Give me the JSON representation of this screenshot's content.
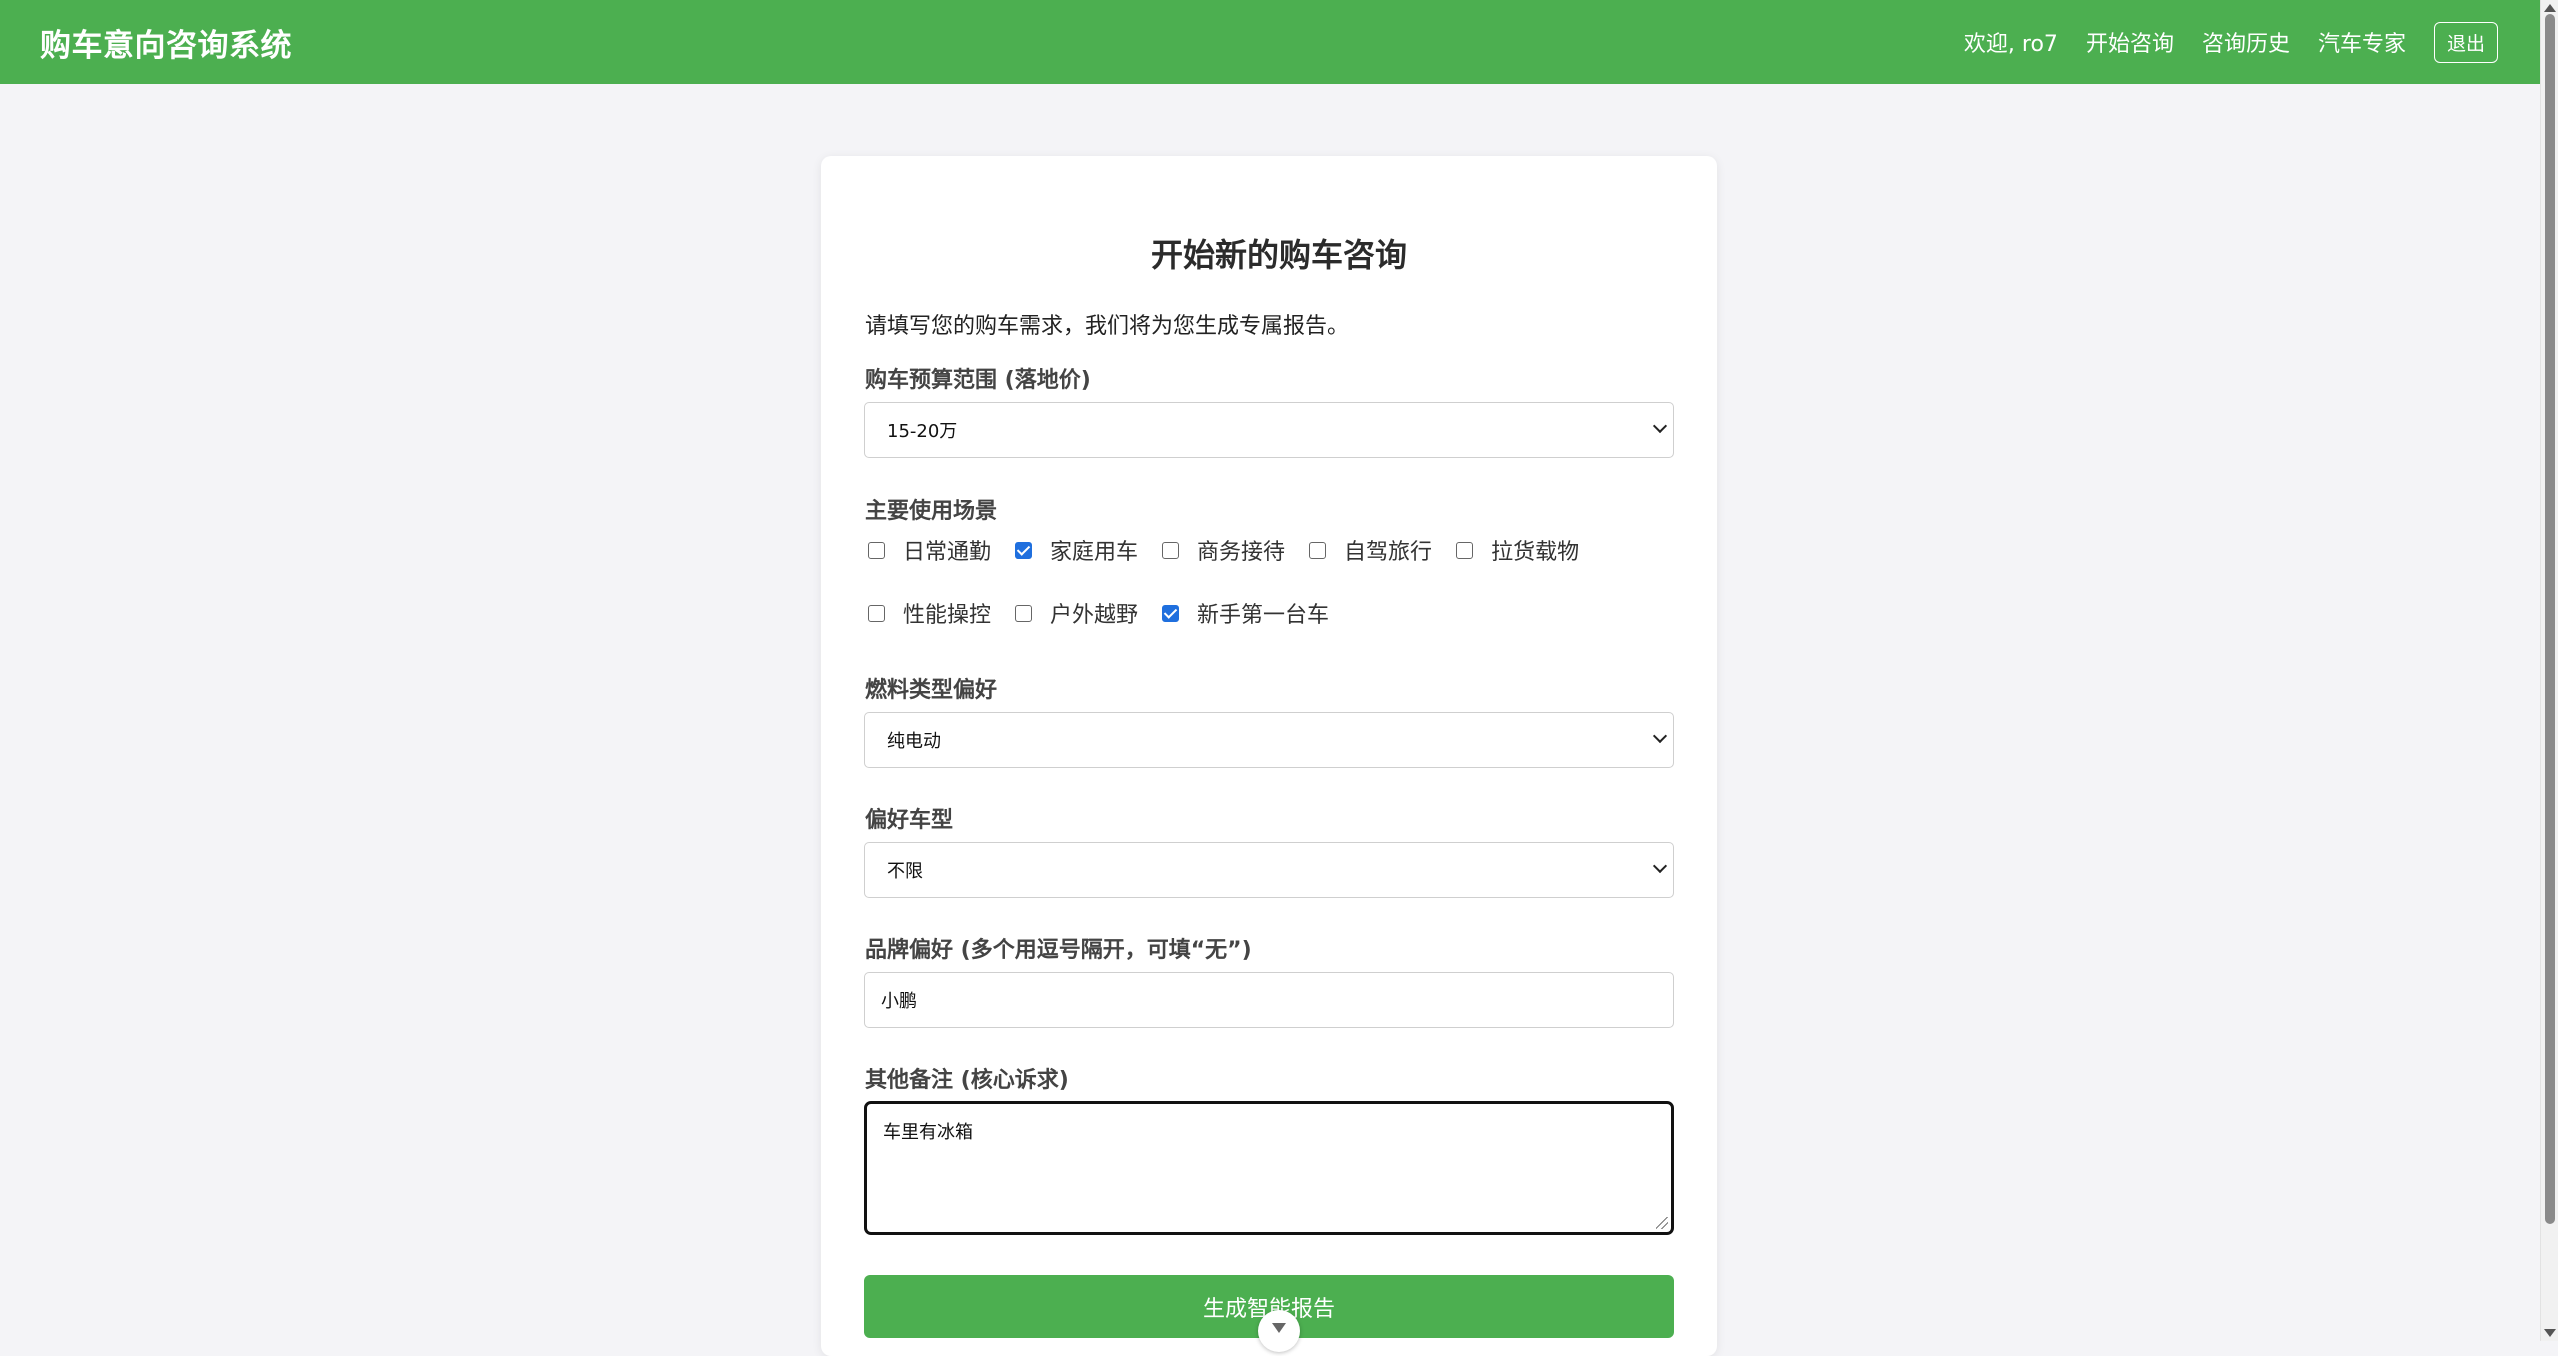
{
  "app": {
    "title": "购车意向咨询系统"
  },
  "nav": {
    "welcome": "欢迎, ro7",
    "start_consult": "开始咨询",
    "history": "咨询历史",
    "expert": "汽车专家",
    "logout": "退出"
  },
  "form": {
    "title": "开始新的购车咨询",
    "intro": "请填写您的购车需求，我们将为您生成专属报告。",
    "budget": {
      "label": "购车预算范围 (落地价)",
      "value": "15-20万"
    },
    "scenarios": {
      "label": "主要使用场景",
      "options": [
        {
          "label": "日常通勤",
          "checked": false
        },
        {
          "label": "家庭用车",
          "checked": true
        },
        {
          "label": "商务接待",
          "checked": false
        },
        {
          "label": "自驾旅行",
          "checked": false
        },
        {
          "label": "拉货载物",
          "checked": false
        },
        {
          "label": "性能操控",
          "checked": false
        },
        {
          "label": "户外越野",
          "checked": false
        },
        {
          "label": "新手第一台车",
          "checked": true
        }
      ]
    },
    "fuel": {
      "label": "燃料类型偏好",
      "value": "纯电动"
    },
    "body_type": {
      "label": "偏好车型",
      "value": "不限"
    },
    "brand": {
      "label": "品牌偏好 (多个用逗号隔开，可填“无”)",
      "value": "小鹏"
    },
    "notes": {
      "label": "其他备注 (核心诉求)",
      "value": "车里有冰箱"
    },
    "submit_label": "生成智能报告"
  },
  "colors": {
    "brand_green": "#4caf50",
    "checkbox_blue": "#1f6fde"
  }
}
